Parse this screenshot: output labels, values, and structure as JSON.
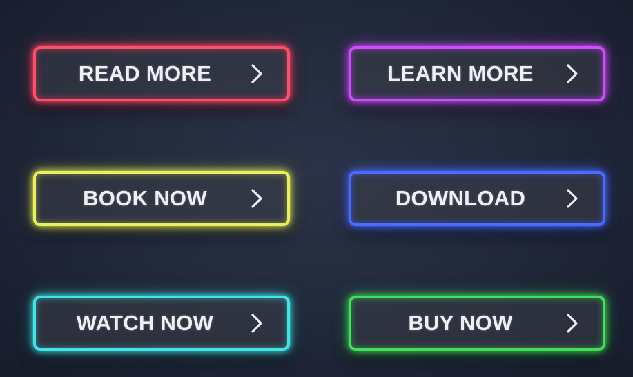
{
  "buttons": [
    {
      "label": "READ MORE",
      "color": "#ff4d6a",
      "glow": "rgba(255,60,90,0.55)",
      "icon": "chevron-right-icon"
    },
    {
      "label": "LEARN MORE",
      "color": "#d04dff",
      "glow": "rgba(200,70,255,0.55)",
      "icon": "chevron-right-icon"
    },
    {
      "label": "BOOK NOW",
      "color": "#e8f05a",
      "glow": "rgba(230,240,80,0.5)",
      "icon": "chevron-right-icon"
    },
    {
      "label": "DOWNLOAD",
      "color": "#4a6bff",
      "glow": "rgba(70,100,255,0.6)",
      "icon": "chevron-right-icon"
    },
    {
      "label": "WATCH NOW",
      "color": "#3fe6e6",
      "glow": "rgba(60,230,230,0.5)",
      "icon": "chevron-right-icon"
    },
    {
      "label": "BUY NOW",
      "color": "#3fe05a",
      "glow": "rgba(60,224,90,0.5)",
      "icon": "chevron-right-icon"
    }
  ]
}
